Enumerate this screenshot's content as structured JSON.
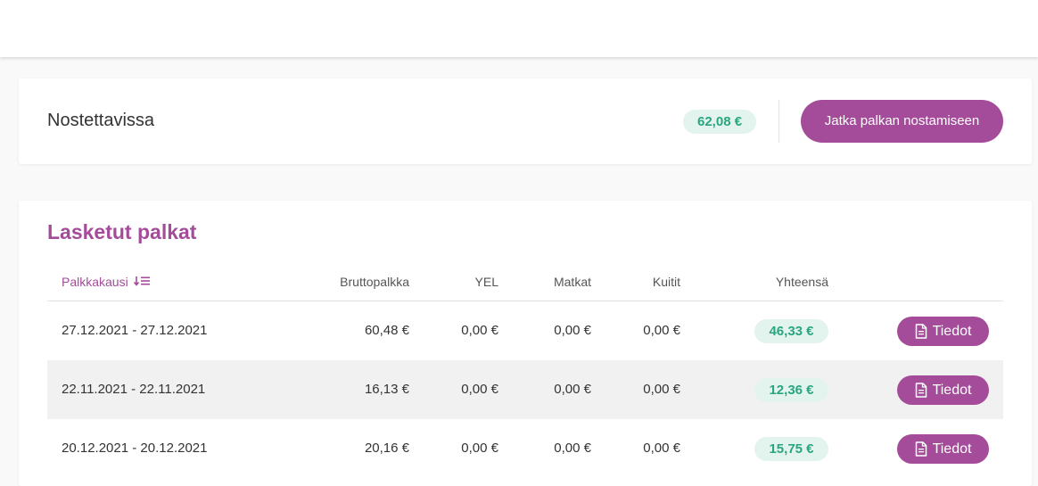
{
  "withdraw": {
    "title": "Nostettavissa",
    "amount": "62,08 €",
    "continue_label": "Jatka palkan nostamiseen"
  },
  "salaries": {
    "title": "Lasketut palkat",
    "columns": {
      "period": "Palkkakausi",
      "gross": "Bruttopalkka",
      "yel": "YEL",
      "travel": "Matkat",
      "receipts": "Kuitit",
      "total": "Yhteensä"
    },
    "sort_icon": "sort-descending-icon",
    "details_icon": "document-icon",
    "rows": [
      {
        "period": "27.12.2021 - 27.12.2021",
        "gross": "60,48 €",
        "yel": "0,00 €",
        "travel": "0,00 €",
        "receipts": "0,00 €",
        "total": "46,33 €",
        "details": "Tiedot"
      },
      {
        "period": "22.11.2021 - 22.11.2021",
        "gross": "16,13 €",
        "yel": "0,00 €",
        "travel": "0,00 €",
        "receipts": "0,00 €",
        "total": "12,36 €",
        "details": "Tiedot"
      },
      {
        "period": "20.12.2021 - 20.12.2021",
        "gross": "20,16 €",
        "yel": "0,00 €",
        "travel": "0,00 €",
        "receipts": "0,00 €",
        "total": "15,75 €",
        "details": "Tiedot"
      }
    ]
  },
  "colors": {
    "accent": "#a44c9a",
    "total_pill_bg": "#e3f4ee",
    "total_pill_text": "#2aa57f",
    "row_stripe": "#f1f1f1"
  }
}
